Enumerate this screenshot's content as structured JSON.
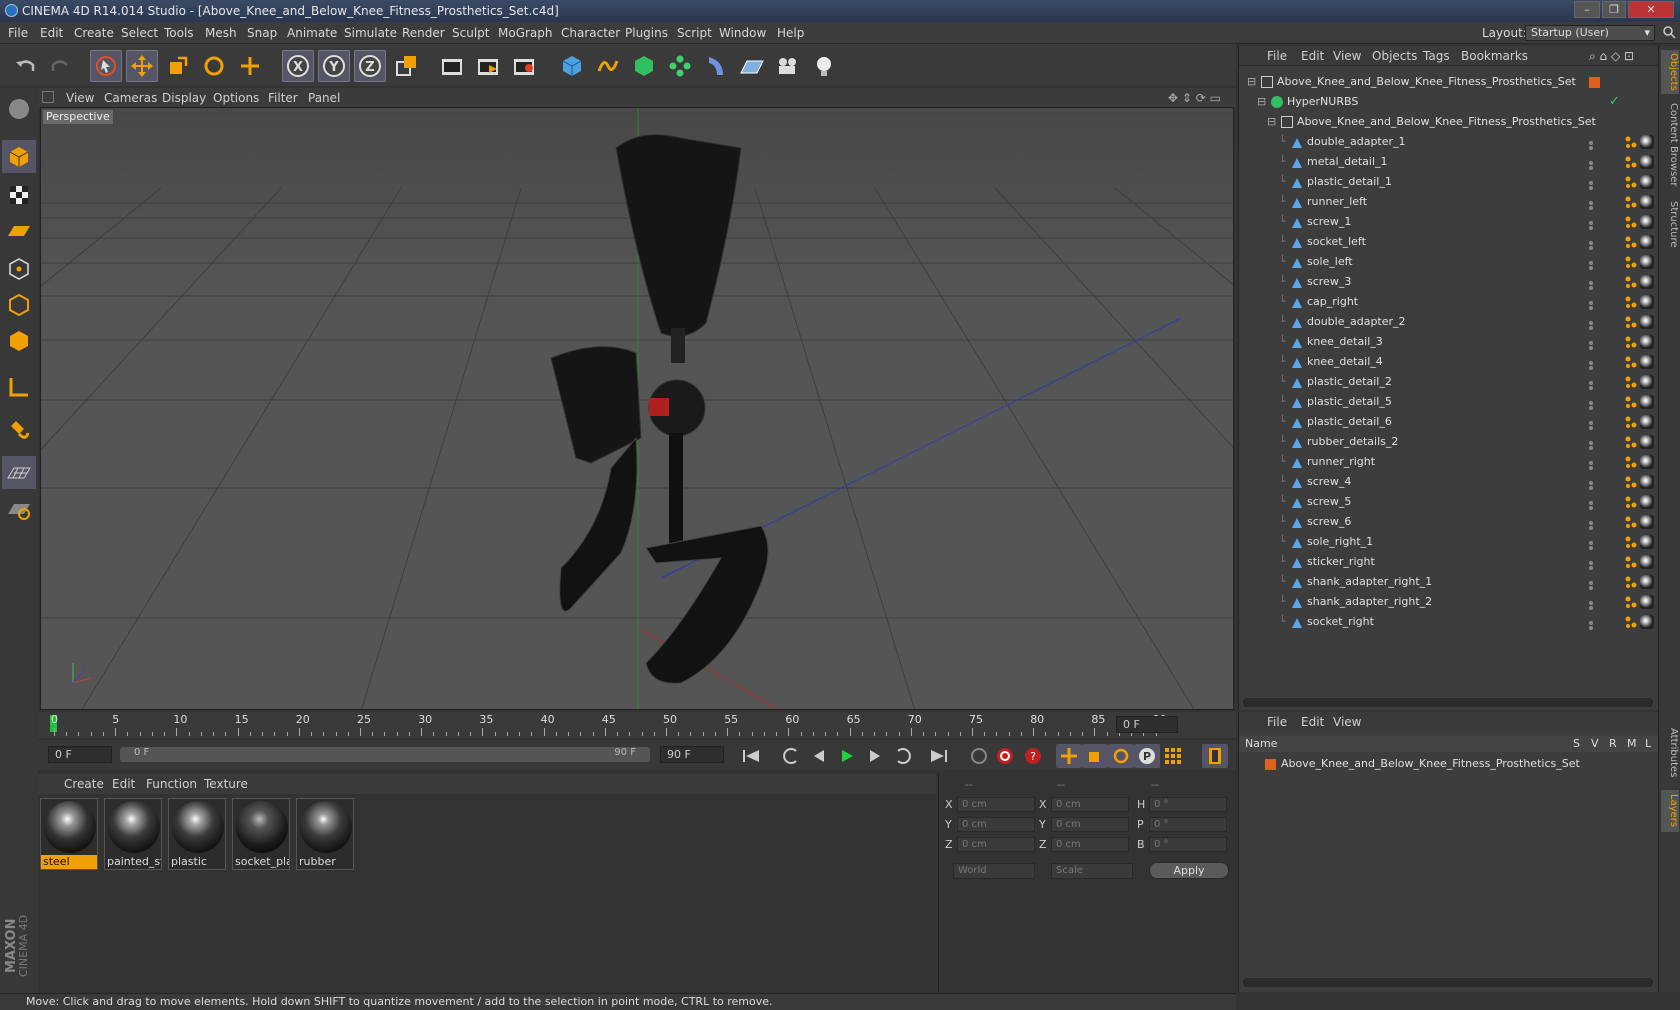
{
  "window": {
    "title": "CINEMA 4D R14.014 Studio - [Above_Knee_and_Below_Knee_Fitness_Prosthetics_Set.c4d]",
    "buttons": [
      "–",
      "❐",
      "✕"
    ]
  },
  "menu": [
    "File",
    "Edit",
    "Create",
    "Select",
    "Tools",
    "Mesh",
    "Snap",
    "Animate",
    "Simulate",
    "Render",
    "Sculpt",
    "MoGraph",
    "Character",
    "Plugins",
    "Script",
    "Window",
    "Help"
  ],
  "layout": {
    "label": "Layout:",
    "value": "Startup (User)"
  },
  "viewport": {
    "menu": [
      "View",
      "Cameras",
      "Display",
      "Options",
      "Filter",
      "Panel"
    ],
    "label": "Perspective"
  },
  "timeline": {
    "ticks": [
      "0",
      "5",
      "10",
      "15",
      "20",
      "25",
      "30",
      "35",
      "40",
      "45",
      "50",
      "55",
      "60",
      "65",
      "70",
      "75",
      "80",
      "85",
      "90"
    ],
    "end_field": "0 F",
    "current_frame": "0 F",
    "range_start": "0 F",
    "range_end": "90 F",
    "max_frame": "90 F"
  },
  "materials": {
    "menu": [
      "Create",
      "Edit",
      "Function",
      "Texture"
    ],
    "items": [
      {
        "name": "steel",
        "selected": true
      },
      {
        "name": "painted_st",
        "selected": false
      },
      {
        "name": "plastic",
        "selected": false
      },
      {
        "name": "socket_plas",
        "selected": false
      },
      {
        "name": "rubber",
        "selected": false
      }
    ]
  },
  "coords": {
    "header": [
      "--",
      "--",
      "--"
    ],
    "rows": [
      {
        "a": "X",
        "av": "0 cm",
        "b": "X",
        "bv": "0 cm",
        "c": "H",
        "cv": "0 °"
      },
      {
        "a": "Y",
        "av": "0 cm",
        "b": "Y",
        "bv": "0 cm",
        "c": "P",
        "cv": "0 °"
      },
      {
        "a": "Z",
        "av": "0 cm",
        "b": "Z",
        "bv": "0 cm",
        "c": "B",
        "cv": "0 °"
      }
    ],
    "world": "World",
    "scale": "Scale",
    "apply": "Apply"
  },
  "objects": {
    "menu": [
      "File",
      "Edit",
      "View",
      "Objects",
      "Tags",
      "Bookmarks"
    ],
    "root": "Above_Knee_and_Below_Knee_Fitness_Prosthetics_Set",
    "hypernurbs": "HyperNURBS",
    "group": "Above_Knee_and_Below_Knee_Fitness_Prosthetics_Set",
    "children": [
      "double_adapter_1",
      "metal_detail_1",
      "plastic_detail_1",
      "runner_left",
      "screw_1",
      "socket_left",
      "sole_left",
      "screw_3",
      "cap_right",
      "double_adapter_2",
      "knee_detail_3",
      "knee_detail_4",
      "plastic_detail_2",
      "plastic_detail_5",
      "plastic_detail_6",
      "rubber_details_2",
      "runner_right",
      "screw_4",
      "screw_5",
      "screw_6",
      "sole_right_1",
      "sticker_right",
      "shank_adapter_right_1",
      "shank_adapter_right_2",
      "socket_right"
    ]
  },
  "layers": {
    "menu": [
      "File",
      "Edit",
      "View"
    ],
    "columns": [
      "Name",
      "S",
      "V",
      "R",
      "M",
      "L"
    ],
    "rows": [
      "Above_Knee_and_Below_Knee_Fitness_Prosthetics_Set"
    ]
  },
  "side_tabs": [
    "Objects",
    "Content Browser",
    "Structure",
    "Attributes",
    "Layers"
  ],
  "status": "Move: Click and drag to move elements. Hold down SHIFT to quantize movement / add to the selection in point mode, CTRL to remove.",
  "brand": "MAXON CINEMA 4D",
  "colors": {
    "accent_orange": "#f0a000",
    "selection": "#f6a623",
    "viewport_bg": "#555555"
  }
}
